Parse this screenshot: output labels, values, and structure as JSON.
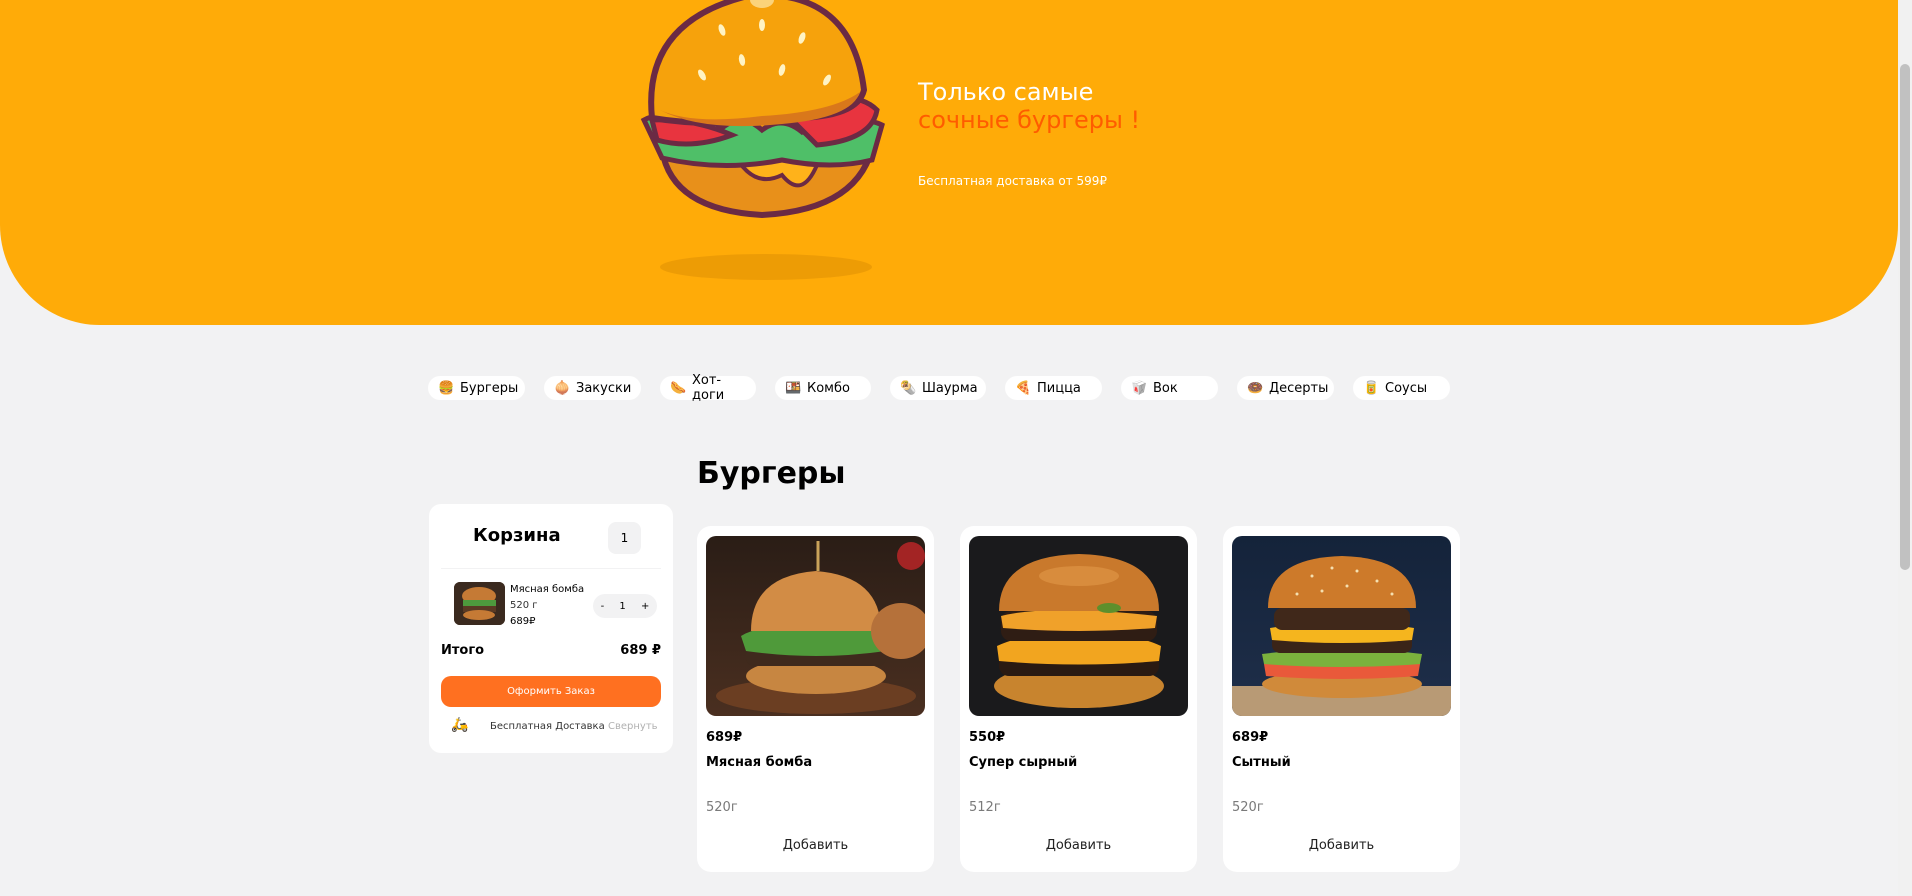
{
  "hero": {
    "title_line1": "Только самые",
    "title_line2": "сочные бургеры !",
    "subtitle": "Бесплатная доставка от 599₽"
  },
  "categories": [
    {
      "label": "Бургеры",
      "icon": "burger-icon"
    },
    {
      "label": "Закуски",
      "icon": "snacks-icon"
    },
    {
      "label": "Хот-доги",
      "icon": "hotdog-icon"
    },
    {
      "label": "Комбо",
      "icon": "combo-icon"
    },
    {
      "label": "Шаурма",
      "icon": "shawarma-icon"
    },
    {
      "label": "Пицца",
      "icon": "pizza-icon"
    },
    {
      "label": "Вок",
      "icon": "wok-icon"
    },
    {
      "label": "Десерты",
      "icon": "donut-icon"
    },
    {
      "label": "Соусы",
      "icon": "sauce-icon"
    }
  ],
  "section_title": "Бургеры",
  "cart": {
    "title": "Корзина",
    "count": "1",
    "item": {
      "name": "Мясная бомба",
      "weight": "520 г",
      "price": "689₽",
      "qty": "1",
      "minus": "-",
      "plus": "+"
    },
    "total_label": "Итого",
    "total_value": "689 ₽",
    "order_button": "Оформить Заказ",
    "delivery_text": "Бесплатная Доставка",
    "collapse": "Свернуть"
  },
  "products": [
    {
      "price": "689₽",
      "name": "Мясная бомба",
      "weight": "520г",
      "add": "Добавить"
    },
    {
      "price": "550₽",
      "name": "Супер сырный",
      "weight": "512г",
      "add": "Добавить"
    },
    {
      "price": "689₽",
      "name": "Сытный",
      "weight": "520г",
      "add": "Добавить"
    }
  ],
  "colors": {
    "brand_yellow": "#ffab08",
    "accent_orange": "#ff7020",
    "accent_red": "#ff5c00",
    "background": "#f2f2f3"
  }
}
